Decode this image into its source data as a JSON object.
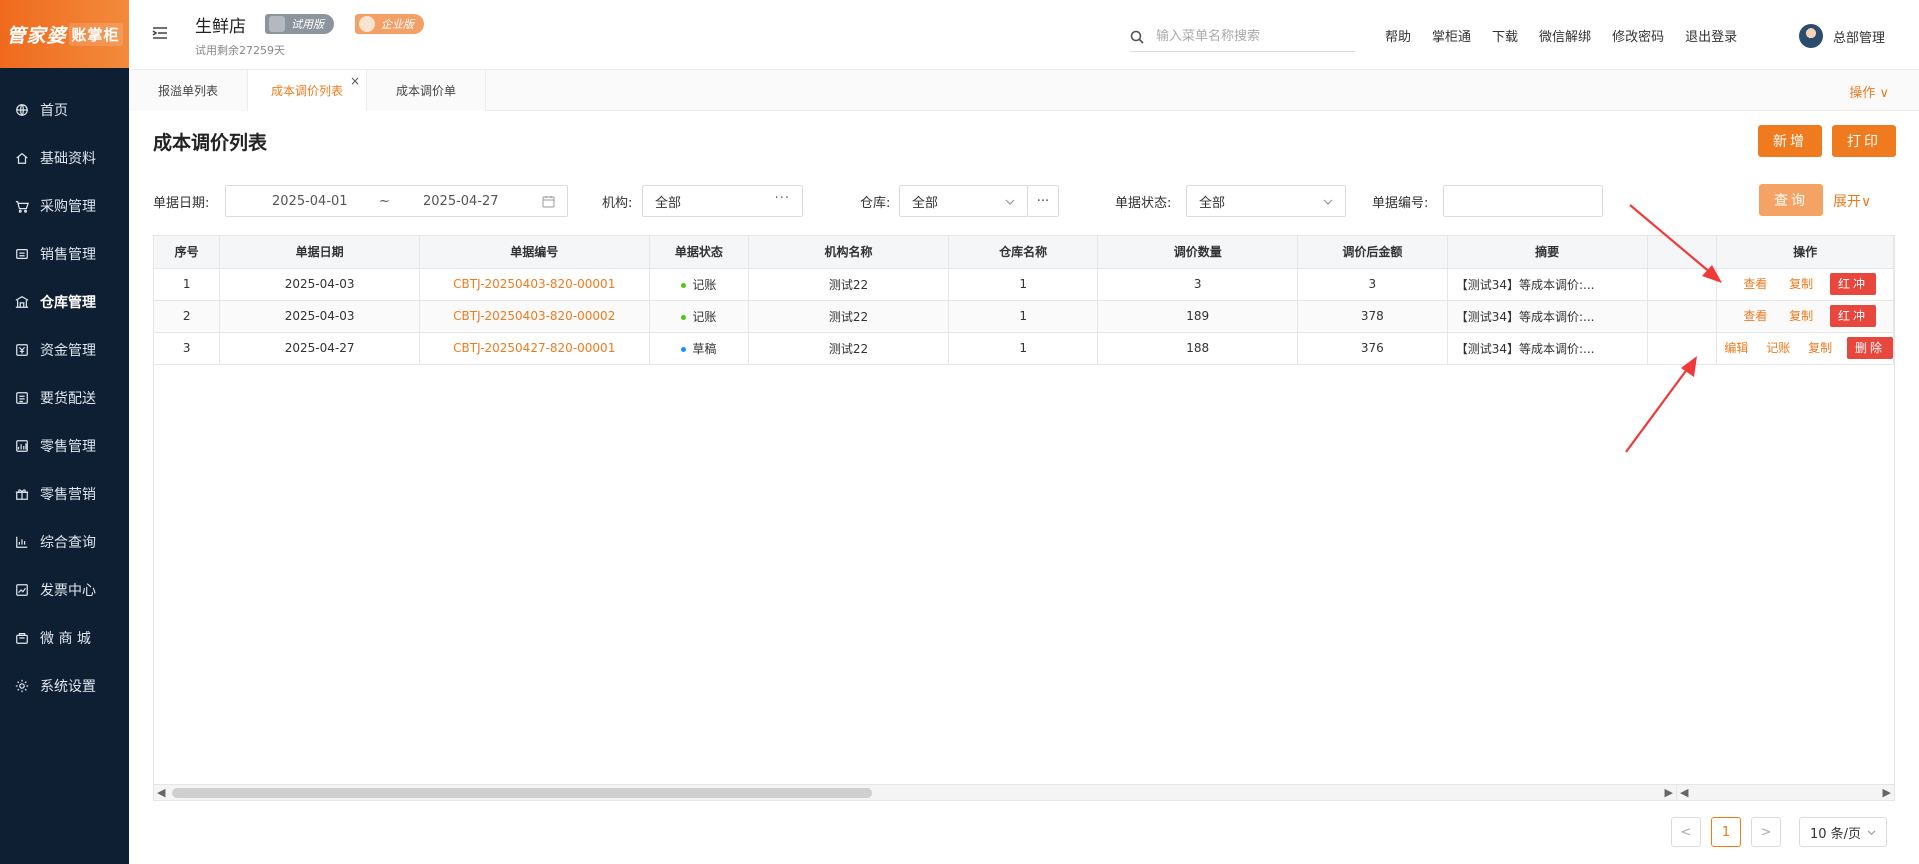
{
  "logo": {
    "part1": "管家婆",
    "part2": "账掌柜"
  },
  "sidebar": {
    "items": [
      {
        "label": "首页",
        "icon": "globe-icon"
      },
      {
        "label": "基础资料",
        "icon": "home-icon"
      },
      {
        "label": "采购管理",
        "icon": "cart-icon"
      },
      {
        "label": "销售管理",
        "icon": "sales-icon"
      },
      {
        "label": "仓库管理",
        "icon": "warehouse-icon"
      },
      {
        "label": "资金管理",
        "icon": "money-icon"
      },
      {
        "label": "要货配送",
        "icon": "delivery-icon"
      },
      {
        "label": "零售管理",
        "icon": "retail-icon"
      },
      {
        "label": "零售营销",
        "icon": "gift-icon"
      },
      {
        "label": "综合查询",
        "icon": "chart-icon"
      },
      {
        "label": "发票中心",
        "icon": "invoice-icon"
      },
      {
        "label": "微 商 城",
        "icon": "shop-icon"
      },
      {
        "label": "系统设置",
        "icon": "gear-icon"
      }
    ],
    "active_index": 4
  },
  "header": {
    "store_name": "生鲜店",
    "badge_trial": "试用版",
    "badge_enterprise": "企业版",
    "trial_remaining": "试用剩余27259天",
    "search_placeholder": "输入菜单名称搜索",
    "links": [
      "帮助",
      "掌柜通",
      "下载",
      "微信解绑",
      "修改密码",
      "退出登录"
    ],
    "user_name": "总部管理"
  },
  "tabs": {
    "items": [
      "报溢单列表",
      "成本调价列表",
      "成本调价单"
    ],
    "active_index": 1,
    "close_glyph": "×",
    "ops_label": "操作 ∨"
  },
  "page": {
    "title": "成本调价列表",
    "btn_new": "新增",
    "btn_print": "打印"
  },
  "filters": {
    "date_label": "单据日期:",
    "date_from": "2025-04-01",
    "date_sep": "~",
    "date_to": "2025-04-27",
    "org_label": "机构:",
    "org_value": "全部",
    "warehouse_label": "仓库:",
    "warehouse_value": "全部",
    "status_label": "单据状态:",
    "status_value": "全部",
    "code_label": "单据编号:",
    "code_value": "",
    "query_label": "查询",
    "expand_label": "展开∨",
    "more_glyph": "···"
  },
  "table": {
    "columns": [
      "序号",
      "单据日期",
      "单据编号",
      "单据状态",
      "机构名称",
      "仓库名称",
      "调价数量",
      "调价后金额",
      "摘要",
      "",
      "操作"
    ],
    "rows": [
      {
        "no": "1",
        "date": "2025-04-03",
        "code": "CBTJ-20250403-820-00001",
        "status": "记账",
        "status_color": "#52c41a",
        "org": "测试22",
        "wh": "1",
        "qty": "3",
        "amount": "3",
        "summary": "【测试34】等成本调价:...",
        "ops": [
          "查看",
          "复制"
        ],
        "op_btn": "红冲"
      },
      {
        "no": "2",
        "date": "2025-04-03",
        "code": "CBTJ-20250403-820-00002",
        "status": "记账",
        "status_color": "#52c41a",
        "org": "测试22",
        "wh": "1",
        "qty": "189",
        "amount": "378",
        "summary": "【测试34】等成本调价:...",
        "ops": [
          "查看",
          "复制"
        ],
        "op_btn": "红冲"
      },
      {
        "no": "3",
        "date": "2025-04-27",
        "code": "CBTJ-20250427-820-00001",
        "status": "草稿",
        "status_color": "#1890ff",
        "org": "测试22",
        "wh": "1",
        "qty": "188",
        "amount": "376",
        "summary": "【测试34】等成本调价:...",
        "ops": [
          "编辑",
          "记账",
          "复制"
        ],
        "op_btn": "删除"
      }
    ]
  },
  "pagination": {
    "prev": "<",
    "current": "1",
    "next": ">",
    "page_size": "10 条/页"
  },
  "colors": {
    "accent": "#f07b1f",
    "danger": "#e8473e",
    "sidebar_bg": "#0f1f33",
    "annotation_arrow": "#f03a3a"
  }
}
